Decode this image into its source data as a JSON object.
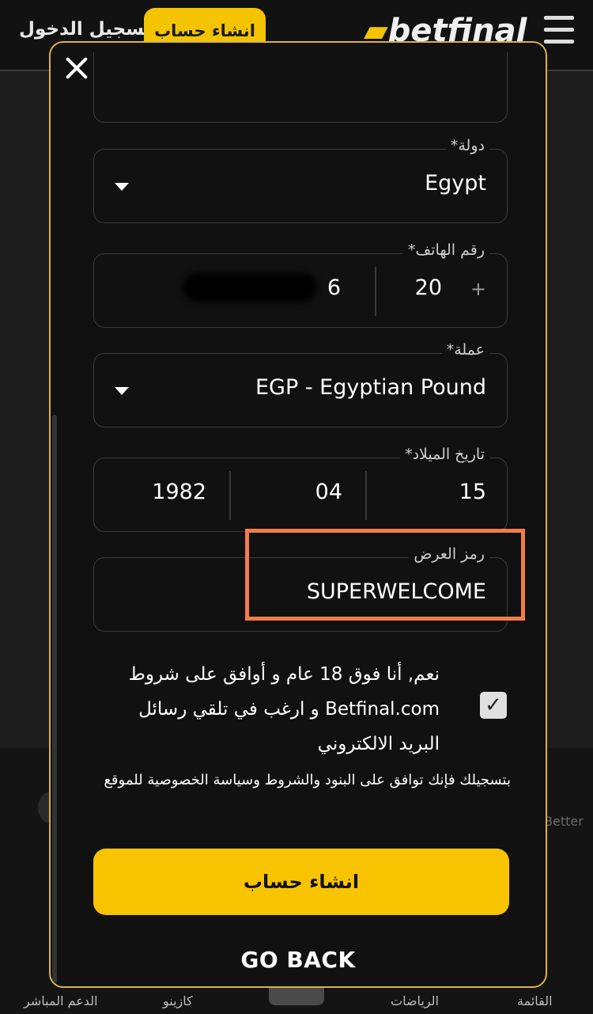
{
  "topbar": {
    "login_label": "تسجيل الدخول",
    "register_label": "انشاء حساب",
    "logo_text": "betfinal",
    "menu_icon": "hamburger-icon"
  },
  "background": {
    "better_text": "Better"
  },
  "bottom_nav": {
    "items": [
      "القائمة",
      "الرياضات",
      "كازينو",
      "الدعم المباشر"
    ]
  },
  "modal": {
    "close_icon": "close-icon",
    "country": {
      "label": "دولة*",
      "value": "Egypt"
    },
    "phone": {
      "label": "رقم الهاتف*",
      "prefix": "+",
      "code": "20",
      "number": "6"
    },
    "currency": {
      "label": "عملة*",
      "value": "EGP - Egyptian Pound"
    },
    "birthdate": {
      "label": "تاريخ الميلاد*",
      "day": "15",
      "month": "04",
      "year": "1982"
    },
    "promo": {
      "label": "رمز العرض",
      "value": "SUPERWELCOME"
    },
    "consent_checked": true,
    "consent_text": "نعم, أنا فوق 18 عام و أوافق على شروط Betfinal.com و ارغب في تلقي رسائل البريد الالكتروني",
    "terms_text": "بتسجيلك فإنك توافق على البنود والشروط وسياسة الخصوصية للموقع",
    "submit_label": "انشاء حساب",
    "go_back_label": "GO BACK"
  },
  "colors": {
    "accent": "#f8c400",
    "modal_border": "#d8b24a",
    "highlight": "#f47c4a"
  }
}
